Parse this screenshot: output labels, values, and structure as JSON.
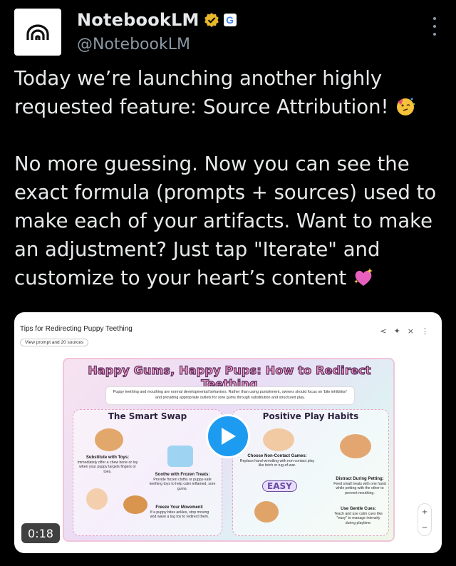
{
  "author": {
    "display_name": "NotebookLM",
    "handle": "@NotebookLM",
    "affiliate_badge": "G"
  },
  "tweet": {
    "paragraph_1": "Today we’re launching another highly requested feature: Source Attribution!",
    "paragraph_2": "No more guessing. Now you can see the exact formula (prompts + sources) used to make each of your artifacts. Want to make an adjustment? Just tap \"Iterate\" and customize to your heart’s content",
    "emoji_1": "partying-face",
    "emoji_2": "sparkling-heart"
  },
  "media": {
    "title": "Tips for Redirecting Puppy Teething",
    "chip": "View prompt and 20 sources",
    "video_time": "0:18",
    "zoom_in": "+",
    "zoom_out": "−",
    "poster": {
      "title": "Happy Gums, Happy Pups: How to Redirect Teething",
      "intro": "Puppy teething and mouthing are normal developmental behaviors. Rather than using punishment, owners should focus on 'bite inhibition' and providing appropriate outlets for sore gums through substitution and structured play.",
      "left_heading": "The Smart Swap",
      "right_heading": "Positive Play Habits",
      "easy_label": "EASY",
      "tips": [
        {
          "title": "Substitute with Toys:",
          "body": "Immediately offer a chew bone or toy when your puppy targets fingers or toes."
        },
        {
          "title": "Soothe with Frozen Treats:",
          "body": "Provide frozen cloths or puppy-safe teething toys to help calm inflamed, sore gums."
        },
        {
          "title": "Freeze Your Movement:",
          "body": "If a puppy bites ankles, stop moving and wave a tug toy to redirect them."
        },
        {
          "title": "Choose Non-Contact Games:",
          "body": "Replace hand-wrestling with non-contact play like fetch or tug-of-war."
        },
        {
          "title": "Distract During Petting:",
          "body": "Feed small treats with one hand while petting with the other to prevent mouthing."
        },
        {
          "title": "Use Gentle Cues:",
          "body": "Teach and use calm cues like \"easy\" to manage intensity during playtime."
        }
      ]
    }
  },
  "colors": {
    "background": "#000000",
    "text": "#e7e9ea",
    "secondary_text": "#8b98a5",
    "play_button": "#1d9bf0",
    "verified_gold": "#e8b829"
  }
}
